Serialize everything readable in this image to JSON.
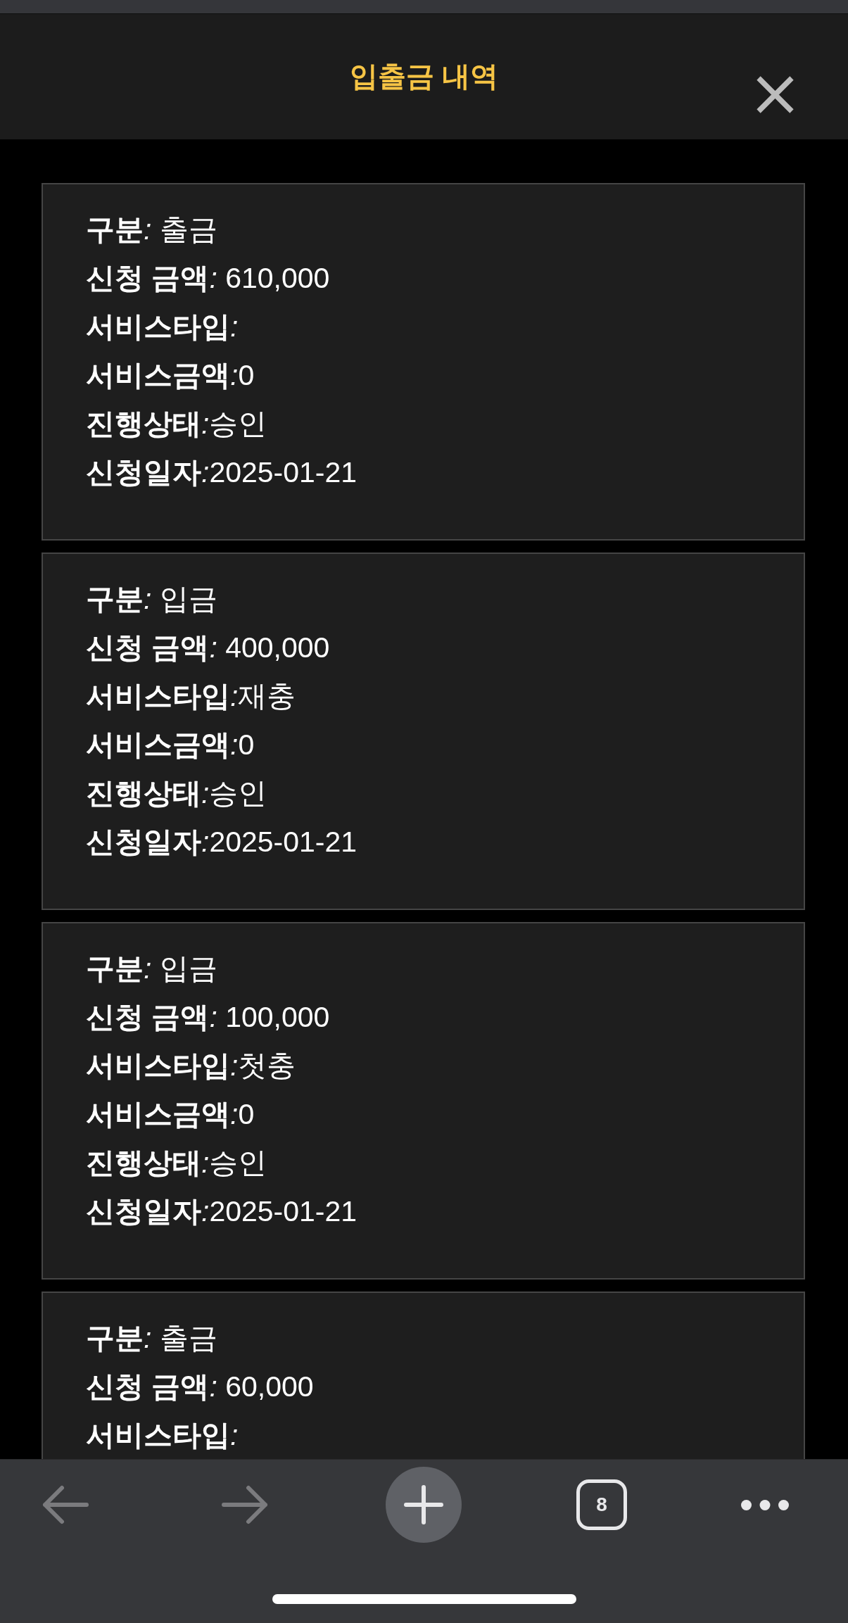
{
  "header": {
    "title": "입출금 내역"
  },
  "records": [
    {
      "lines": [
        {
          "label": "구분",
          "separator": ": ",
          "value": "출금"
        },
        {
          "label": "신청 금액",
          "separator": ": ",
          "value": "610,000"
        },
        {
          "label": "서비스타입",
          "separator": ":"
        },
        {
          "label": "서비스금액",
          "separator": ":",
          "value": "0"
        },
        {
          "label": "진행상태",
          "separator": ":",
          "value": "승인"
        },
        {
          "label": "신청일자",
          "separator": ":",
          "value": "2025-01-21"
        }
      ]
    },
    {
      "lines": [
        {
          "label": "구분",
          "separator": ": ",
          "value": "입금"
        },
        {
          "label": "신청 금액",
          "separator": ": ",
          "value": "400,000"
        },
        {
          "label": "서비스타입",
          "separator": ":",
          "value": "재충"
        },
        {
          "label": "서비스금액",
          "separator": ":",
          "value": "0"
        },
        {
          "label": "진행상태",
          "separator": ":",
          "value": "승인"
        },
        {
          "label": "신청일자",
          "separator": ":",
          "value": "2025-01-21"
        }
      ]
    },
    {
      "lines": [
        {
          "label": "구분",
          "separator": ": ",
          "value": "입금"
        },
        {
          "label": "신청 금액",
          "separator": ": ",
          "value": "100,000"
        },
        {
          "label": "서비스타입",
          "separator": ":",
          "value": "첫충"
        },
        {
          "label": "서비스금액",
          "separator": ":",
          "value": "0"
        },
        {
          "label": "진행상태",
          "separator": ":",
          "value": "승인"
        },
        {
          "label": "신청일자",
          "separator": ":",
          "value": "2025-01-21"
        }
      ]
    },
    {
      "lines": [
        {
          "label": "구분",
          "separator": ": ",
          "value": "출금"
        },
        {
          "label": "신청 금액",
          "separator": ": ",
          "value": "60,000"
        },
        {
          "label": "서비스타입",
          "separator": ":"
        }
      ]
    }
  ],
  "toolbar": [
    {
      "kind": "back",
      "disabled": true
    },
    {
      "kind": "forward",
      "disabled": true
    },
    {
      "kind": "new_tab",
      "disabled": false
    },
    {
      "kind": "tab_count",
      "label": "8",
      "disabled": false
    },
    {
      "kind": "more",
      "disabled": false
    }
  ]
}
